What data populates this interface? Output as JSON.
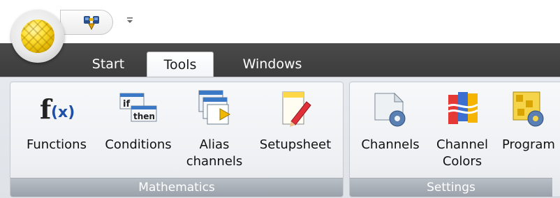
{
  "tabs": [
    {
      "label": "Start",
      "active": false
    },
    {
      "label": "Tools",
      "active": true
    },
    {
      "label": "Windows",
      "active": false
    }
  ],
  "groups": [
    {
      "label": "Mathematics",
      "buttons": [
        {
          "label": "Functions",
          "icon": "function-fx-icon"
        },
        {
          "label": "Conditions",
          "icon": "if-then-icon"
        },
        {
          "label": "Alias\nchannels",
          "icon": "alias-windows-icon"
        },
        {
          "label": "Setupsheet",
          "icon": "setupsheet-pencil-icon"
        }
      ]
    },
    {
      "label": "Settings",
      "buttons": [
        {
          "label": "Channels",
          "icon": "channels-gear-icon"
        },
        {
          "label": "Channel\nColors",
          "icon": "channel-colors-icon"
        },
        {
          "label": "Program",
          "icon": "program-gear-icon"
        }
      ]
    }
  ],
  "colors": {
    "tabstrip": "#3f3f3f",
    "ribbon": "#e6eaef",
    "accent": "#ffd400"
  }
}
